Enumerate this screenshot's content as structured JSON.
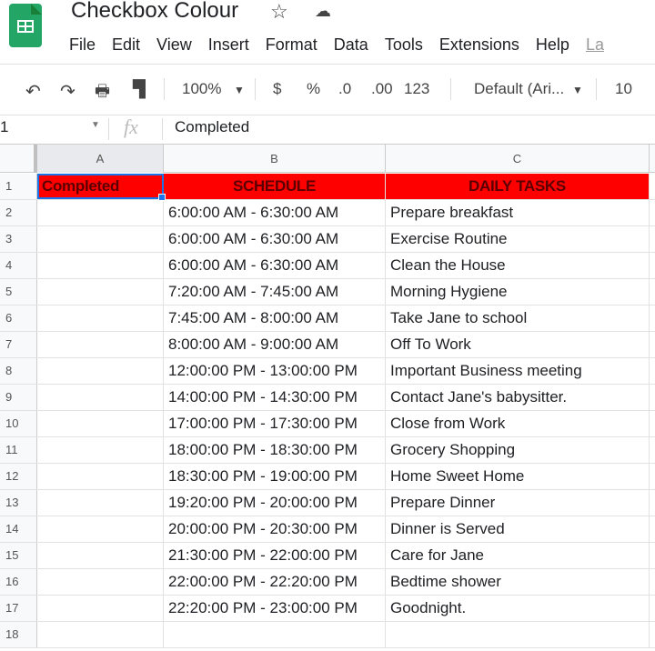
{
  "app": {
    "title": "Checkbox Colour",
    "menu": [
      "File",
      "Edit",
      "View",
      "Insert",
      "Format",
      "Data",
      "Tools",
      "Extensions",
      "Help",
      "La"
    ]
  },
  "toolbar": {
    "zoom": "100%",
    "currency": "$",
    "percent": "%",
    "dec_decrease": ".0",
    "dec_increase": ".00",
    "format": "123",
    "font": "Default (Ari...",
    "font_size": "10"
  },
  "formula_bar": {
    "cell_ref": "1",
    "fx": "fx",
    "value": "Completed"
  },
  "columns": [
    "A",
    "B",
    "C"
  ],
  "header_row": [
    "Completed",
    "SCHEDULE",
    "DAILY TASKS"
  ],
  "rows": [
    [
      "6:00:00 AM - 6:30:00 AM",
      "Prepare breakfast"
    ],
    [
      "6:00:00 AM - 6:30:00 AM",
      "Exercise Routine"
    ],
    [
      "6:00:00 AM - 6:30:00 AM",
      "Clean the House"
    ],
    [
      "7:20:00 AM - 7:45:00 AM",
      "Morning Hygiene"
    ],
    [
      "7:45:00 AM - 8:00:00 AM",
      "Take Jane to school"
    ],
    [
      "8:00:00 AM - 9:00:00 AM",
      "Off To Work"
    ],
    [
      "12:00:00 PM - 13:00:00 PM",
      "Important Business meeting"
    ],
    [
      "14:00:00 PM - 14:30:00 PM",
      "Contact Jane's babysitter."
    ],
    [
      "17:00:00 PM - 17:30:00 PM",
      "Close from Work"
    ],
    [
      "18:00:00 PM - 18:30:00 PM",
      "Grocery Shopping"
    ],
    [
      "18:30:00 PM - 19:00:00 PM",
      "Home Sweet Home"
    ],
    [
      "19:20:00 PM - 20:00:00 PM",
      "Prepare Dinner"
    ],
    [
      "20:00:00 PM - 20:30:00 PM",
      "Dinner is Served"
    ],
    [
      "21:30:00 PM - 22:00:00 PM",
      "Care for Jane"
    ],
    [
      "22:00:00 PM - 22:20:00 PM",
      "Bedtime shower"
    ],
    [
      "22:20:00 PM - 23:00:00 PM",
      "Goodnight."
    ],
    [
      "",
      ""
    ]
  ],
  "colors": {
    "header_fill": "#ff0000",
    "selection": "#1a73e8"
  }
}
